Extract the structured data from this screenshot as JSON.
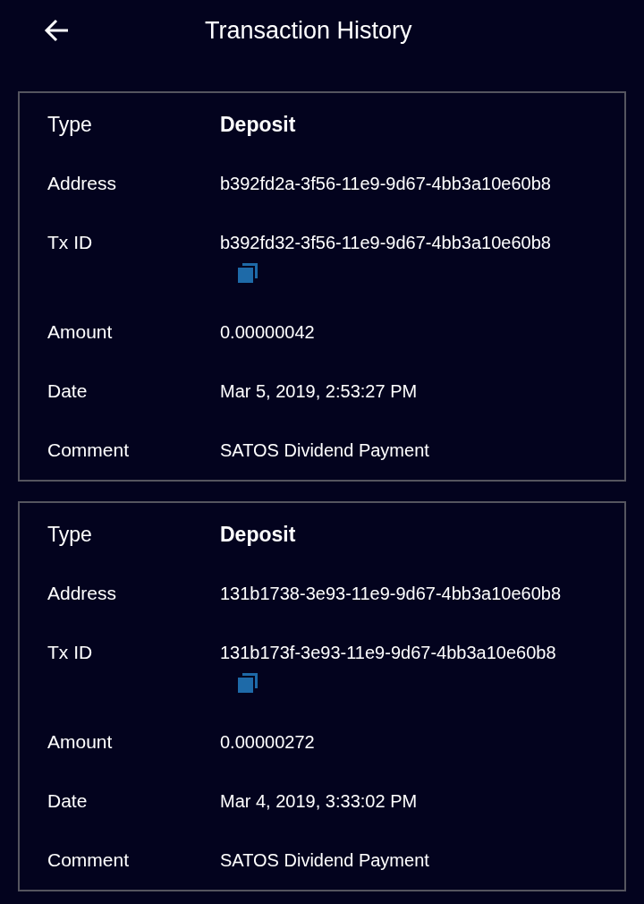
{
  "header": {
    "title": "Transaction History"
  },
  "transactions": [
    {
      "rows": [
        {
          "kind": "type",
          "label": "Type",
          "value": "Deposit"
        },
        {
          "kind": "plain",
          "label": "Address",
          "value": "b392fd2a-3f56-11e9-9d67-4bb3a10e60b8"
        },
        {
          "kind": "copyable",
          "label": "Tx ID",
          "value": "b392fd32-3f56-11e9-9d67-4bb3a10e60b8"
        },
        {
          "kind": "plain",
          "label": "Amount",
          "value": "0.00000042"
        },
        {
          "kind": "plain",
          "label": "Date",
          "value": "Mar 5, 2019, 2:53:27 PM"
        },
        {
          "kind": "plain",
          "label": "Comment",
          "value": "SATOS Dividend Payment"
        }
      ]
    },
    {
      "rows": [
        {
          "kind": "type",
          "label": "Type",
          "value": "Deposit"
        },
        {
          "kind": "plain",
          "label": "Address",
          "value": "131b1738-3e93-11e9-9d67-4bb3a10e60b8"
        },
        {
          "kind": "copyable",
          "label": "Tx ID",
          "value": "131b173f-3e93-11e9-9d67-4bb3a10e60b8"
        },
        {
          "kind": "plain",
          "label": "Amount",
          "value": "0.00000272"
        },
        {
          "kind": "plain",
          "label": "Date",
          "value": "Mar 4, 2019, 3:33:02 PM"
        },
        {
          "kind": "plain",
          "label": "Comment",
          "value": "SATOS Dividend Payment"
        }
      ]
    }
  ]
}
